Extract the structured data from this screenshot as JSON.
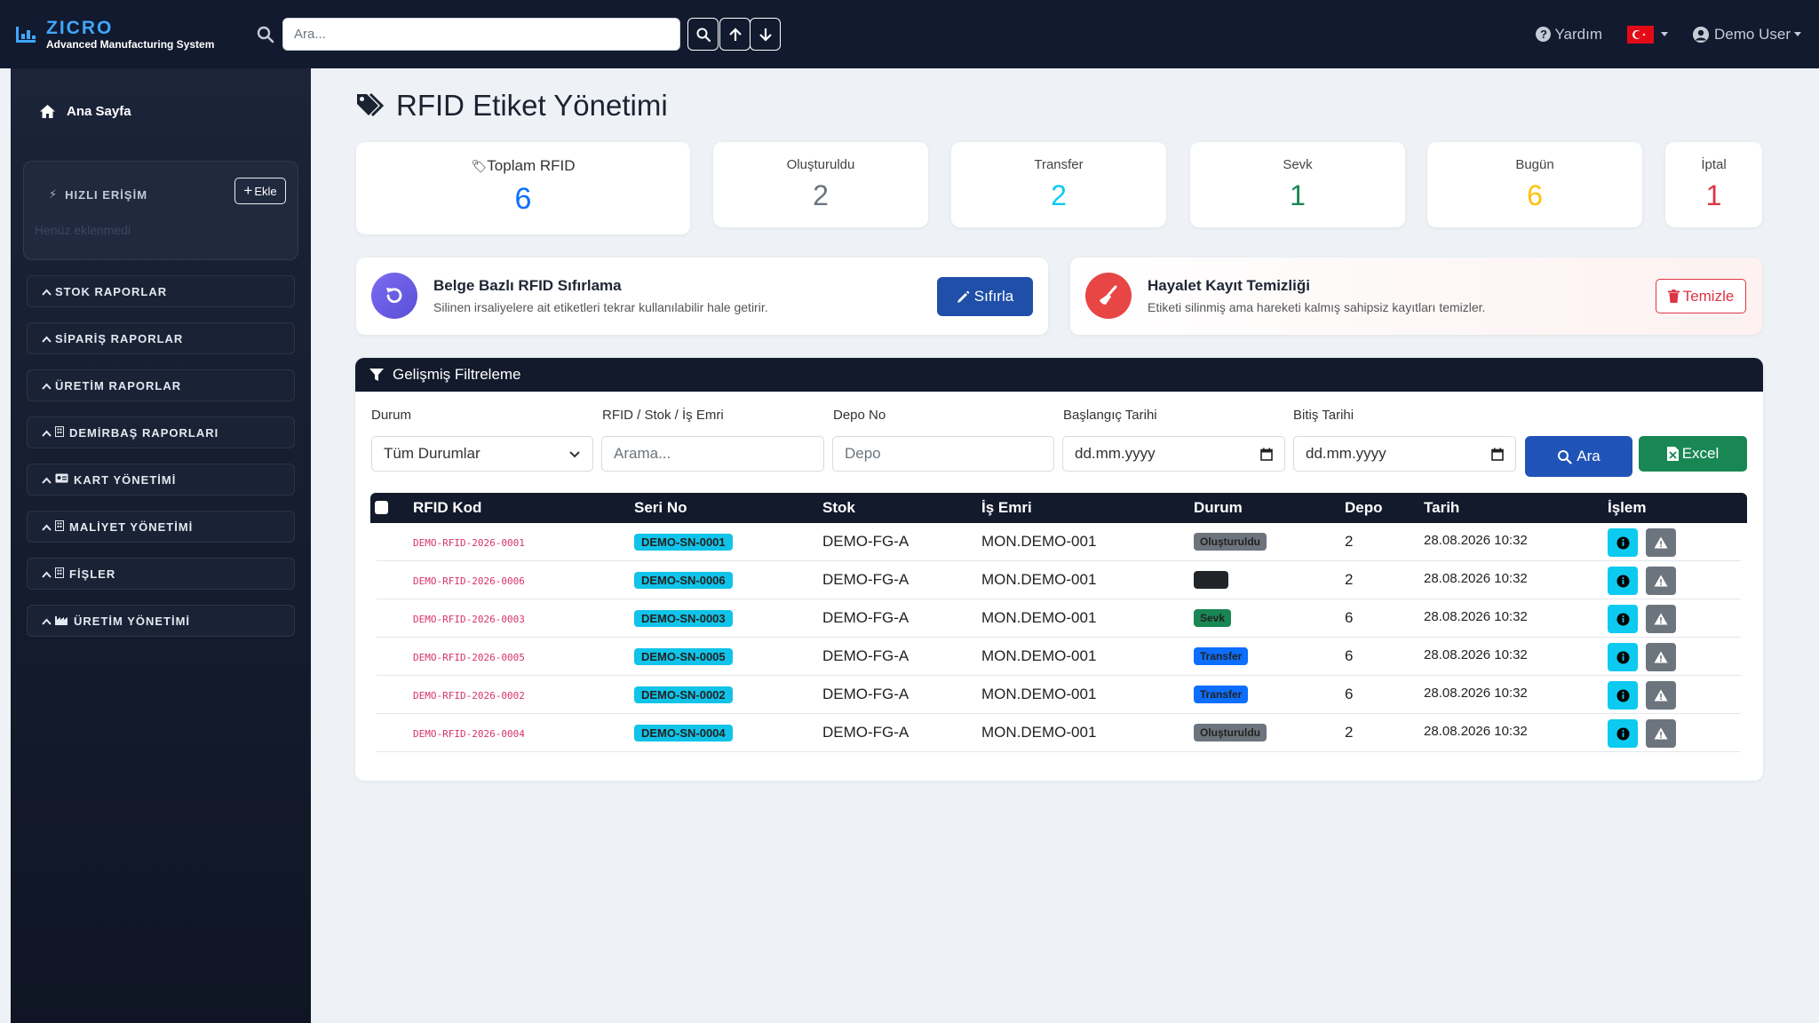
{
  "app": {
    "brand_name": "ZICRO",
    "brand_subtitle": "Advanced Manufacturing System",
    "search_placeholder": "Ara..."
  },
  "topbar": {
    "help_label": "Yardım",
    "user_label": "Demo User"
  },
  "sidebar": {
    "home_label": "Ana Sayfa",
    "quick_access_title": "HIZLI ERİŞİM",
    "add_label": "Ekle",
    "quick_empty_text": "Henüz eklenmedi",
    "menu": [
      {
        "label": "STOK RAPORLAR",
        "icon": ""
      },
      {
        "label": "SİPARİŞ RAPORLAR",
        "icon": ""
      },
      {
        "label": "ÜRETİM RAPORLAR",
        "icon": ""
      },
      {
        "label": "DEMİRBAŞ RAPORLARI",
        "icon": "building-icon"
      },
      {
        "label": "KART YÖNETİMİ",
        "icon": "id-card-icon"
      },
      {
        "label": "MALİYET YÖNETİMİ",
        "icon": "building-icon"
      },
      {
        "label": "FİŞLER",
        "icon": "building-icon"
      },
      {
        "label": "ÜRETİM YÖNETİMİ",
        "icon": "industry-icon"
      }
    ]
  },
  "page": {
    "title": "RFID Etiket Yönetimi"
  },
  "stats": [
    {
      "label": "Toplam RFID",
      "value": "6",
      "color": "#0d6efd"
    },
    {
      "label": "Oluşturuldu",
      "value": "2",
      "color": "#6c757d"
    },
    {
      "label": "Transfer",
      "value": "2",
      "color": "#0dcaf0"
    },
    {
      "label": "Sevk",
      "value": "1",
      "color": "#198754"
    },
    {
      "label": "Bugün",
      "value": "6",
      "color": "#ffc107"
    },
    {
      "label": "İptal",
      "value": "1",
      "color": "#dc3545"
    }
  ],
  "cards": {
    "reset": {
      "title": "Belge Bazlı RFID Sıfırlama",
      "desc": "Silinen irsaliyelere ait etiketleri tekrar kullanılabilir hale getirir.",
      "button": "Sıfırla"
    },
    "ghost": {
      "title": "Hayalet Kayıt Temizliği",
      "desc": "Etiketi silinmiş ama hareketi kalmış sahipsiz kayıtları temizler.",
      "button": "Temizle"
    }
  },
  "filters": {
    "title": "Gelişmiş Filtreleme",
    "status_label": "Durum",
    "status_value": "Tüm Durumlar",
    "search_label": "RFID / Stok / İş Emri",
    "search_placeholder": "Arama...",
    "depot_label": "Depo No",
    "depot_placeholder": "Depo",
    "start_label": "Başlangıç Tarihi",
    "start_value": "dd.mm.yyyy",
    "end_label": "Bitiş Tarihi",
    "end_value": "dd.mm.yyyy",
    "search_button": "Ara",
    "excel_button": "Excel"
  },
  "table": {
    "columns": [
      "RFID Kod",
      "Seri No",
      "Stok",
      "İş Emri",
      "Durum",
      "Depo",
      "Tarih",
      "İşlem"
    ],
    "rows": [
      {
        "rfid": "DEMO-RFID-2026-0001",
        "serial": "DEMO-SN-0001",
        "stock": "DEMO-FG-A",
        "order": "MON.DEMO-001",
        "status": "Oluşturuldu",
        "status_color": "#6c757d",
        "depot": "2",
        "date": "28.08.2026 10:32"
      },
      {
        "rfid": "DEMO-RFID-2026-0006",
        "serial": "DEMO-SN-0006",
        "stock": "DEMO-FG-A",
        "order": "MON.DEMO-001",
        "status": "İptal",
        "status_color": "#212529",
        "depot": "2",
        "date": "28.08.2026 10:32"
      },
      {
        "rfid": "DEMO-RFID-2026-0003",
        "serial": "DEMO-SN-0003",
        "stock": "DEMO-FG-A",
        "order": "MON.DEMO-001",
        "status": "Sevk",
        "status_color": "#198754",
        "depot": "6",
        "date": "28.08.2026 10:32"
      },
      {
        "rfid": "DEMO-RFID-2026-0005",
        "serial": "DEMO-SN-0005",
        "stock": "DEMO-FG-A",
        "order": "MON.DEMO-001",
        "status": "Transfer",
        "status_color": "#0d6efd",
        "depot": "6",
        "date": "28.08.2026 10:32"
      },
      {
        "rfid": "DEMO-RFID-2026-0002",
        "serial": "DEMO-SN-0002",
        "stock": "DEMO-FG-A",
        "order": "MON.DEMO-001",
        "status": "Transfer",
        "status_color": "#0d6efd",
        "depot": "6",
        "date": "28.08.2026 10:32"
      },
      {
        "rfid": "DEMO-RFID-2026-0004",
        "serial": "DEMO-SN-0004",
        "stock": "DEMO-FG-A",
        "order": "MON.DEMO-001",
        "status": "Oluşturuldu",
        "status_color": "#6c757d",
        "depot": "2",
        "date": "28.08.2026 10:32"
      }
    ]
  }
}
